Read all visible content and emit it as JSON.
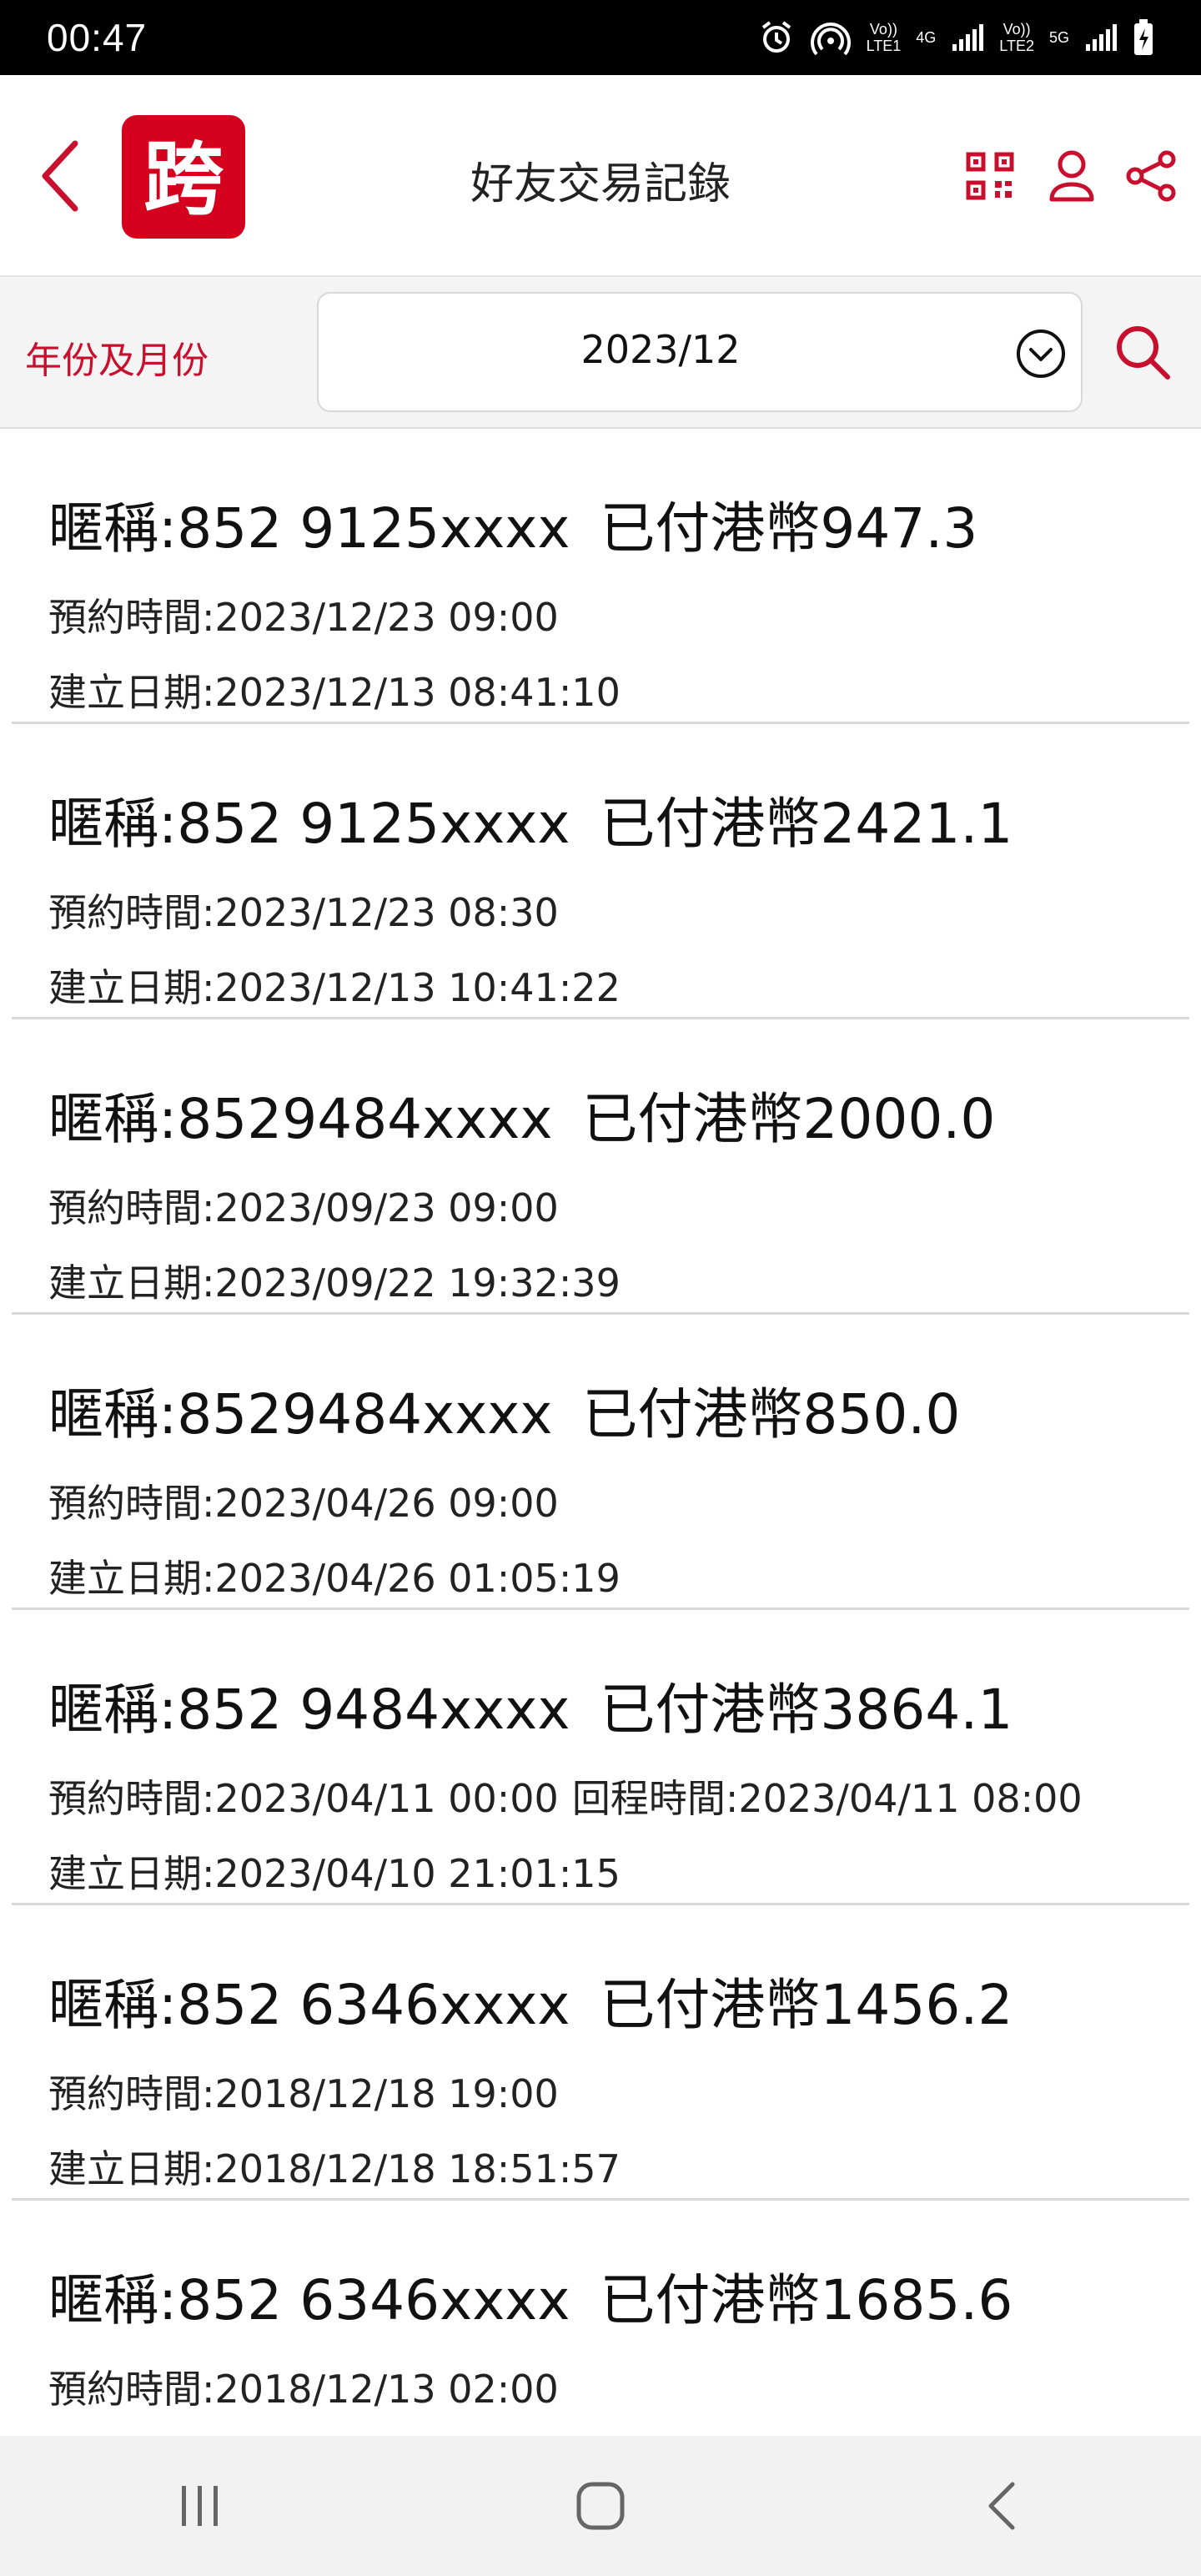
{
  "status_bar": {
    "time": "00:47",
    "sim1_label": "LTE1",
    "sim2_label": "LTE2",
    "net1": "4G",
    "net2": "5G",
    "volte1": "Vo))",
    "volte2": "Vo))"
  },
  "header": {
    "title": "好友交易記錄",
    "logo_glyph": "跨",
    "brand_color": "#d4001e"
  },
  "filter": {
    "label": "年份及月份",
    "selected_month": "2023/12"
  },
  "records": [
    {
      "nickname": "暱稱:852 9125xxxx",
      "paid": "已付港幣947.3",
      "booking": "預約時間:2023/12/23 09:00",
      "return": "",
      "created": "建立日期:2023/12/13 08:41:10"
    },
    {
      "nickname": "暱稱:852 9125xxxx",
      "paid": "已付港幣2421.1",
      "booking": "預約時間:2023/12/23 08:30",
      "return": "",
      "created": "建立日期:2023/12/13 10:41:22"
    },
    {
      "nickname": "暱稱:8529484xxxx",
      "paid": "已付港幣2000.0",
      "booking": "預約時間:2023/09/23 09:00",
      "return": "",
      "created": "建立日期:2023/09/22 19:32:39"
    },
    {
      "nickname": "暱稱:8529484xxxx",
      "paid": "已付港幣850.0",
      "booking": "預約時間:2023/04/26 09:00",
      "return": "",
      "created": "建立日期:2023/04/26 01:05:19"
    },
    {
      "nickname": "暱稱:852 9484xxxx",
      "paid": "已付港幣3864.1",
      "booking": "預約時間:2023/04/11 00:00",
      "return": "回程時間:2023/04/11 08:00",
      "created": "建立日期:2023/04/10 21:01:15"
    },
    {
      "nickname": "暱稱:852 6346xxxx",
      "paid": "已付港幣1456.2",
      "booking": "預約時間:2018/12/18 19:00",
      "return": "",
      "created": "建立日期:2018/12/18 18:51:57"
    },
    {
      "nickname": "暱稱:852 6346xxxx",
      "paid": "已付港幣1685.6",
      "booking": "預約時間:2018/12/13 02:00",
      "return": "",
      "created": ""
    }
  ],
  "icons": {
    "back": "chevron-left-icon",
    "qr": "qr-code-icon",
    "profile": "user-icon",
    "share": "share-icon",
    "dropdown": "chevron-down-circle-icon",
    "search": "search-icon"
  },
  "colors": {
    "accent": "#c8102e",
    "divider": "#d9d9d9"
  }
}
